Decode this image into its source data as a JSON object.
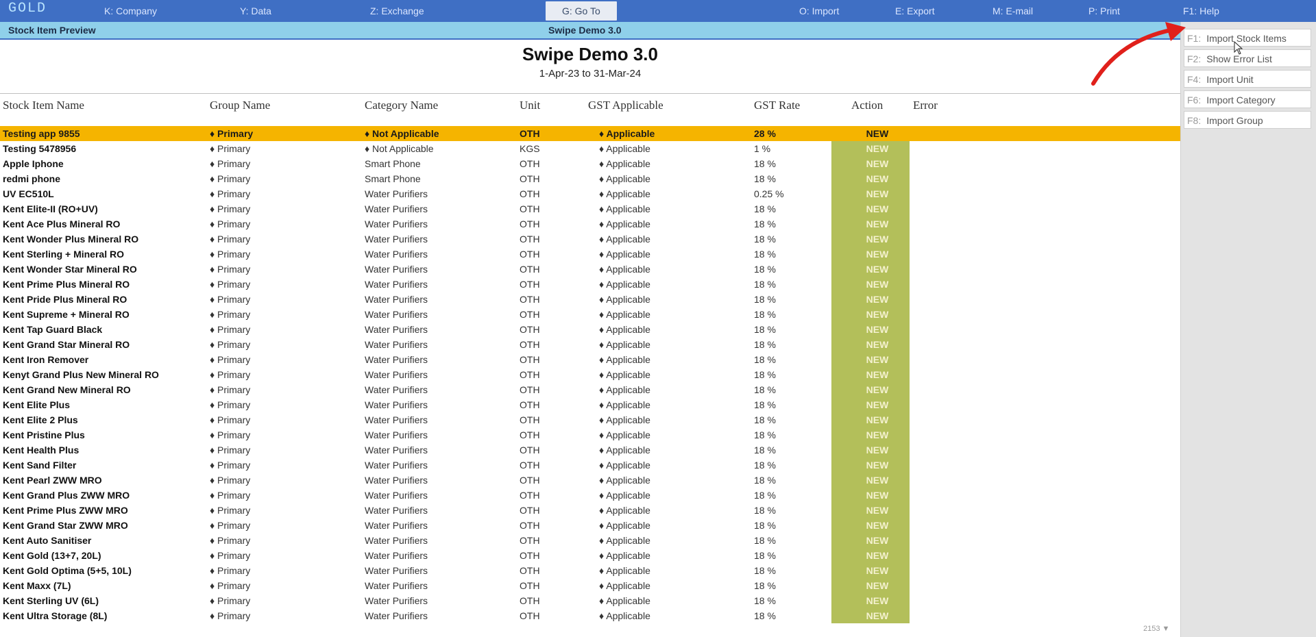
{
  "topbar": {
    "logo": "GOLD",
    "menus": [
      {
        "id": "company",
        "label": "K: Company"
      },
      {
        "id": "data",
        "label": "Y: Data"
      },
      {
        "id": "exchange",
        "label": "Z: Exchange"
      },
      {
        "id": "goto",
        "label": "G: Go To"
      },
      {
        "id": "import",
        "label": "O: Import"
      },
      {
        "id": "export",
        "label": "E: Export"
      },
      {
        "id": "email",
        "label": "M: E-mail"
      },
      {
        "id": "print",
        "label": "P: Print"
      },
      {
        "id": "help",
        "label": "F1: Help"
      }
    ]
  },
  "subbar": {
    "left": "Stock Item Preview",
    "center": "Swipe Demo 3.0"
  },
  "report": {
    "company": "Swipe Demo 3.0",
    "period": "1-Apr-23 to 31-Mar-24"
  },
  "columns": {
    "name": "Stock Item Name",
    "group": "Group Name",
    "category": "Category Name",
    "unit": "Unit",
    "gst": "GST Applicable",
    "rate": "GST Rate",
    "action": "Action",
    "error": "Error"
  },
  "rows": [
    {
      "name": "Testing app 9855",
      "group": "♦ Primary",
      "category": "♦ Not Applicable",
      "unit": "OTH",
      "gst": "♦ Applicable",
      "rate": "28 %",
      "action": "NEW"
    },
    {
      "name": "Testing 5478956",
      "group": "♦ Primary",
      "category": "♦ Not Applicable",
      "unit": "KGS",
      "gst": "♦ Applicable",
      "rate": "1 %",
      "action": "NEW"
    },
    {
      "name": "Apple Iphone",
      "group": "♦ Primary",
      "category": "Smart Phone",
      "unit": "OTH",
      "gst": "♦ Applicable",
      "rate": "18 %",
      "action": "NEW"
    },
    {
      "name": "redmi phone",
      "group": "♦ Primary",
      "category": "Smart Phone",
      "unit": "OTH",
      "gst": "♦ Applicable",
      "rate": "18 %",
      "action": "NEW"
    },
    {
      "name": "UV EC510L",
      "group": "♦ Primary",
      "category": "Water Purifiers",
      "unit": "OTH",
      "gst": "♦ Applicable",
      "rate": "0.25 %",
      "action": "NEW"
    },
    {
      "name": "Kent Elite-II (RO+UV)",
      "group": "♦ Primary",
      "category": "Water Purifiers",
      "unit": "OTH",
      "gst": "♦ Applicable",
      "rate": "18 %",
      "action": "NEW"
    },
    {
      "name": "Kent Ace Plus Mineral RO",
      "group": "♦ Primary",
      "category": "Water Purifiers",
      "unit": "OTH",
      "gst": "♦ Applicable",
      "rate": "18 %",
      "action": "NEW"
    },
    {
      "name": "Kent Wonder Plus Mineral RO",
      "group": "♦ Primary",
      "category": "Water Purifiers",
      "unit": "OTH",
      "gst": "♦ Applicable",
      "rate": "18 %",
      "action": "NEW"
    },
    {
      "name": "Kent Sterling + Mineral RO",
      "group": "♦ Primary",
      "category": "Water Purifiers",
      "unit": "OTH",
      "gst": "♦ Applicable",
      "rate": "18 %",
      "action": "NEW"
    },
    {
      "name": "Kent Wonder Star Mineral RO",
      "group": "♦ Primary",
      "category": "Water Purifiers",
      "unit": "OTH",
      "gst": "♦ Applicable",
      "rate": "18 %",
      "action": "NEW"
    },
    {
      "name": "Kent Prime Plus Mineral RO",
      "group": "♦ Primary",
      "category": "Water Purifiers",
      "unit": "OTH",
      "gst": "♦ Applicable",
      "rate": "18 %",
      "action": "NEW"
    },
    {
      "name": "Kent Pride Plus Mineral RO",
      "group": "♦ Primary",
      "category": "Water Purifiers",
      "unit": "OTH",
      "gst": "♦ Applicable",
      "rate": "18 %",
      "action": "NEW"
    },
    {
      "name": "Kent Supreme + Mineral RO",
      "group": "♦ Primary",
      "category": "Water Purifiers",
      "unit": "OTH",
      "gst": "♦ Applicable",
      "rate": "18 %",
      "action": "NEW"
    },
    {
      "name": "Kent Tap Guard Black",
      "group": "♦ Primary",
      "category": "Water Purifiers",
      "unit": "OTH",
      "gst": "♦ Applicable",
      "rate": "18 %",
      "action": "NEW"
    },
    {
      "name": "Kent Grand Star Mineral RO",
      "group": "♦ Primary",
      "category": "Water Purifiers",
      "unit": "OTH",
      "gst": "♦ Applicable",
      "rate": "18 %",
      "action": "NEW"
    },
    {
      "name": "Kent Iron Remover",
      "group": "♦ Primary",
      "category": "Water Purifiers",
      "unit": "OTH",
      "gst": "♦ Applicable",
      "rate": "18 %",
      "action": "NEW"
    },
    {
      "name": "Kenyt Grand Plus New Mineral RO",
      "group": "♦ Primary",
      "category": "Water Purifiers",
      "unit": "OTH",
      "gst": "♦ Applicable",
      "rate": "18 %",
      "action": "NEW"
    },
    {
      "name": "Kent Grand New Mineral RO",
      "group": "♦ Primary",
      "category": "Water Purifiers",
      "unit": "OTH",
      "gst": "♦ Applicable",
      "rate": "18 %",
      "action": "NEW"
    },
    {
      "name": "Kent Elite Plus",
      "group": "♦ Primary",
      "category": "Water Purifiers",
      "unit": "OTH",
      "gst": "♦ Applicable",
      "rate": "18 %",
      "action": "NEW"
    },
    {
      "name": "Kent Elite 2 Plus",
      "group": "♦ Primary",
      "category": "Water Purifiers",
      "unit": "OTH",
      "gst": "♦ Applicable",
      "rate": "18 %",
      "action": "NEW"
    },
    {
      "name": "Kent Pristine Plus",
      "group": "♦ Primary",
      "category": "Water Purifiers",
      "unit": "OTH",
      "gst": "♦ Applicable",
      "rate": "18 %",
      "action": "NEW"
    },
    {
      "name": "Kent Health Plus",
      "group": "♦ Primary",
      "category": "Water Purifiers",
      "unit": "OTH",
      "gst": "♦ Applicable",
      "rate": "18 %",
      "action": "NEW"
    },
    {
      "name": "Kent Sand Filter",
      "group": "♦ Primary",
      "category": "Water Purifiers",
      "unit": "OTH",
      "gst": "♦ Applicable",
      "rate": "18 %",
      "action": "NEW"
    },
    {
      "name": "Kent Pearl ZWW MRO",
      "group": "♦ Primary",
      "category": "Water Purifiers",
      "unit": "OTH",
      "gst": "♦ Applicable",
      "rate": "18 %",
      "action": "NEW"
    },
    {
      "name": "Kent Grand Plus ZWW MRO",
      "group": "♦ Primary",
      "category": "Water Purifiers",
      "unit": "OTH",
      "gst": "♦ Applicable",
      "rate": "18 %",
      "action": "NEW"
    },
    {
      "name": "Kent Prime Plus ZWW MRO",
      "group": "♦ Primary",
      "category": "Water Purifiers",
      "unit": "OTH",
      "gst": "♦ Applicable",
      "rate": "18 %",
      "action": "NEW"
    },
    {
      "name": "Kent Grand Star ZWW MRO",
      "group": "♦ Primary",
      "category": "Water Purifiers",
      "unit": "OTH",
      "gst": "♦ Applicable",
      "rate": "18 %",
      "action": "NEW"
    },
    {
      "name": "Kent Auto Sanitiser",
      "group": "♦ Primary",
      "category": "Water Purifiers",
      "unit": "OTH",
      "gst": "♦ Applicable",
      "rate": "18 %",
      "action": "NEW"
    },
    {
      "name": "Kent Gold (13+7, 20L)",
      "group": "♦ Primary",
      "category": "Water Purifiers",
      "unit": "OTH",
      "gst": "♦ Applicable",
      "rate": "18 %",
      "action": "NEW"
    },
    {
      "name": "Kent Gold Optima (5+5, 10L)",
      "group": "♦ Primary",
      "category": "Water Purifiers",
      "unit": "OTH",
      "gst": "♦ Applicable",
      "rate": "18 %",
      "action": "NEW"
    },
    {
      "name": "Kent Maxx (7L)",
      "group": "♦ Primary",
      "category": "Water Purifiers",
      "unit": "OTH",
      "gst": "♦ Applicable",
      "rate": "18 %",
      "action": "NEW"
    },
    {
      "name": "Kent Sterling UV (6L)",
      "group": "♦ Primary",
      "category": "Water Purifiers",
      "unit": "OTH",
      "gst": "♦ Applicable",
      "rate": "18 %",
      "action": "NEW"
    },
    {
      "name": "Kent Ultra Storage (8L)",
      "group": "♦ Primary",
      "category": "Water Purifiers",
      "unit": "OTH",
      "gst": "♦ Applicable",
      "rate": "18 %",
      "action": "NEW"
    }
  ],
  "pager": "2153 ▼",
  "sidepanel": {
    "buttons": [
      {
        "key": "F1:",
        "label": "Import Stock Items"
      },
      {
        "key": "F2:",
        "label": "Show Error List"
      },
      {
        "key": "F4:",
        "label": "Import Unit"
      },
      {
        "key": "F6:",
        "label": "Import Category"
      },
      {
        "key": "F8:",
        "label": "Import Group"
      }
    ]
  },
  "colors": {
    "topbar": "#3f6fc4",
    "subbar": "#8fd0ea",
    "selected_row": "#f5b400",
    "action_column": "#b3bf5a",
    "annotation_arrow": "#e0201b"
  }
}
